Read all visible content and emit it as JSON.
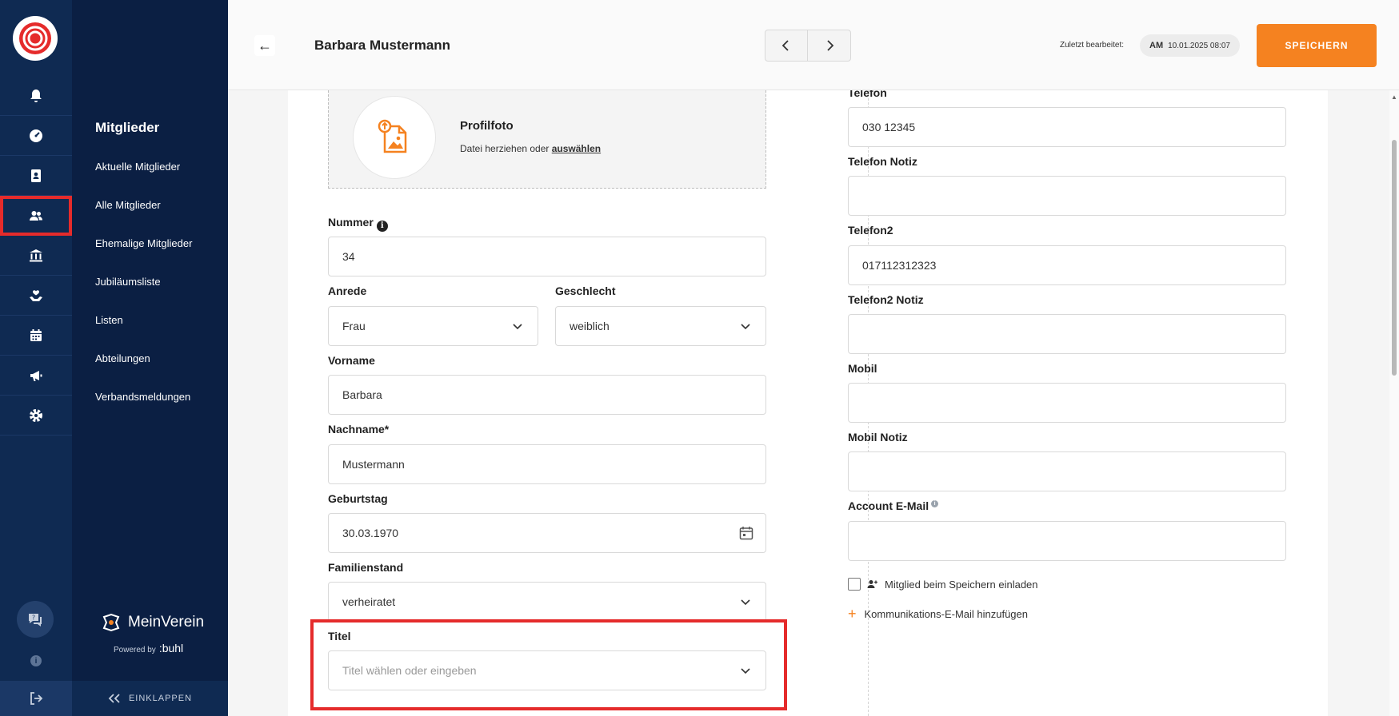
{
  "rail": {
    "icons": [
      "bell-icon",
      "dashboard-icon",
      "contacts-icon",
      "members-icon",
      "bank-icon",
      "care-icon",
      "calendar-icon",
      "megaphone-icon",
      "gear-icon"
    ],
    "active": "members-icon"
  },
  "nav": {
    "section_title": "Mitglieder",
    "items": [
      "Aktuelle Mitglieder",
      "Alle Mitglieder",
      "Ehemalige Mitglieder",
      "Jubiläumsliste",
      "Listen",
      "Abteilungen",
      "Verbandsmeldungen"
    ],
    "brand": "MeinVerein",
    "powered_by": "Powered by",
    "powered_brand": ":buhl",
    "collapse_label": "EINKLAPPEN"
  },
  "header": {
    "title": "Barbara Mustermann",
    "edited_label": "Zuletzt bearbeitet:",
    "editor_initials": "AM",
    "edited_timestamp": "10.01.2025 08:07",
    "save_label": "SPEICHERN"
  },
  "photo": {
    "title": "Profilfoto",
    "drag_text": "Datei herziehen oder",
    "select_link": "auswählen"
  },
  "left_form": {
    "nummer_label": "Nummer",
    "nummer_value": "34",
    "anrede_label": "Anrede",
    "anrede_value": "Frau",
    "geschlecht_label": "Geschlecht",
    "geschlecht_value": "weiblich",
    "vorname_label": "Vorname",
    "vorname_value": "Barbara",
    "nachname_label": "Nachname*",
    "nachname_value": "Mustermann",
    "geburtstag_label": "Geburtstag",
    "geburtstag_value": "30.03.1970",
    "familienstand_label": "Familienstand",
    "familienstand_value": "verheiratet",
    "titel_label": "Titel",
    "titel_placeholder": "Titel wählen oder eingeben"
  },
  "right_form": {
    "telefon_label": "Telefon",
    "telefon_value": "030 12345",
    "telefon_notiz_label": "Telefon Notiz",
    "telefon_notiz_value": "",
    "telefon2_label": "Telefon2",
    "telefon2_value": "017112312323",
    "telefon2_notiz_label": "Telefon2 Notiz",
    "telefon2_notiz_value": "",
    "mobil_label": "Mobil",
    "mobil_value": "",
    "mobil_notiz_label": "Mobil Notiz",
    "mobil_notiz_value": "",
    "account_email_label": "Account E-Mail",
    "account_email_value": "",
    "invite_label": "Mitglied beim Speichern einladen",
    "add_email_label": "Kommunikations-E-Mail hinzufügen"
  },
  "colors": {
    "accent": "#f58220",
    "rail_bg": "#0f2a52",
    "nav_bg": "#0b1f43",
    "highlight": "#e52b2b"
  }
}
